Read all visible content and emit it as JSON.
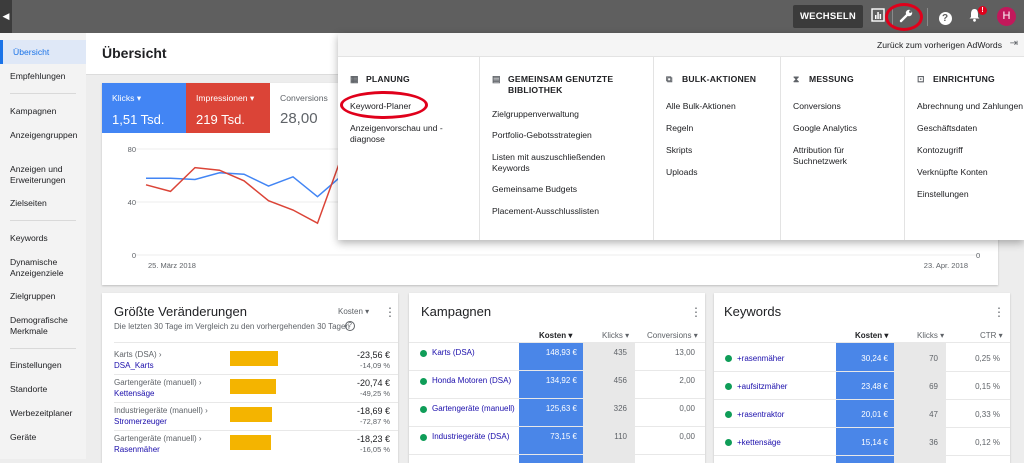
{
  "topbar": {
    "switch_label": "WECHSELN ZU",
    "help_label": "?",
    "bell_badge": "!",
    "avatar_letter": "H"
  },
  "sidebar": {
    "items": [
      "Übersicht",
      "Empfehlungen",
      "Kampagnen",
      "Anzeigengruppen",
      "Anzeigen und Erweiterungen",
      "Zielseiten",
      "Keywords",
      "Dynamische Anzeigenziele",
      "Zielgruppen",
      "Demografische Merkmale",
      "Einstellungen",
      "Standorte",
      "Werbezeitplaner",
      "Geräte"
    ]
  },
  "page": {
    "title": "Übersicht"
  },
  "metrics": [
    {
      "name": "Klicks ▾",
      "value": "1,51 Tsd.",
      "color": "#4285f4"
    },
    {
      "name": "Impressionen ▾",
      "value": "219 Tsd.",
      "color": "#db4437"
    },
    {
      "name": "Conversions",
      "value": "28,00"
    }
  ],
  "chart_data": {
    "type": "line",
    "x": [
      "25. März 2018",
      "23. Apr. 2018"
    ],
    "yticks": [
      "80",
      "40",
      "0"
    ],
    "yticks_right": [
      "0"
    ],
    "series": [
      {
        "name": "Klicks",
        "color": "#4285f4",
        "values": [
          58,
          58,
          57,
          62,
          61,
          52,
          59,
          44,
          60
        ]
      },
      {
        "name": "Impressionen",
        "color": "#db4437",
        "values": [
          53,
          48,
          66,
          64,
          56,
          41,
          34,
          24,
          75
        ]
      }
    ]
  },
  "changes": {
    "title": "Größte Veränderungen",
    "subtitle": "Die letzten 30 Tage im Vergleich zu den vorhergehenden 30 Tagen",
    "sort_label": "Kosten ▾",
    "rows": [
      {
        "campaign": "Karts (DSA) ›",
        "group": "DSA_Karts",
        "value": "-23,56 €",
        "pct": "-14,09 %",
        "bar": 0.83
      },
      {
        "campaign": "Gartengeräte (manuell) ›",
        "group": "Kettensäge",
        "value": "-20,74 €",
        "pct": "-49,25 %",
        "bar": 0.8
      },
      {
        "campaign": "Industriegeräte (manuell) ›",
        "group": "Stromerzeuger",
        "value": "-18,69 €",
        "pct": "-72,87 %",
        "bar": 0.72
      },
      {
        "campaign": "Gartengeräte (manuell) ›",
        "group": "Rasenmäher",
        "value": "-18,23 €",
        "pct": "-16,05 %",
        "bar": 0.7
      }
    ]
  },
  "campaigns": {
    "title": "Kampagnen",
    "cols": [
      "Kosten ▾",
      "Klicks ▾",
      "Conversions ▾"
    ],
    "rows": [
      {
        "name": "Karts (DSA)",
        "cost": "148,93 €",
        "clicks": "435",
        "conv": "13,00"
      },
      {
        "name": "Honda Motoren (DSA)",
        "cost": "134,92 €",
        "clicks": "456",
        "conv": "2,00"
      },
      {
        "name": "Gartengeräte (manuell)",
        "cost": "125,63 €",
        "clicks": "326",
        "conv": "0,00"
      },
      {
        "name": "Industriegeräte (DSA)",
        "cost": "73,15 €",
        "clicks": "110",
        "conv": "0,00"
      }
    ]
  },
  "keywords": {
    "title": "Keywords",
    "cols": [
      "Kosten ▾",
      "Klicks ▾",
      "CTR ▾"
    ],
    "rows": [
      {
        "name": "+rasenmäher",
        "cost": "30,24 €",
        "clicks": "70",
        "ctr": "0,25 %"
      },
      {
        "name": "+aufsitzmäher",
        "cost": "23,48 €",
        "clicks": "69",
        "ctr": "0,15 %"
      },
      {
        "name": "+rasentraktor",
        "cost": "20,01 €",
        "clicks": "47",
        "ctr": "0,33 %"
      },
      {
        "name": "+kettensäge",
        "cost": "15,14 €",
        "clicks": "36",
        "ctr": "0,12 %"
      }
    ]
  },
  "tools_menu": {
    "back_label": "Zurück zum vorherigen AdWords",
    "columns": [
      {
        "title": "PLANUNG",
        "items": [
          "Keyword-Planer",
          "Anzeigenvorschau und -diagnose"
        ]
      },
      {
        "title": "GEMEINSAM GENUTZTE BIBLIOTHEK",
        "items": [
          "Zielgruppenverwaltung",
          "Portfolio-Gebotsstrategien",
          "Listen mit auszuschließenden Keywords",
          "Gemeinsame Budgets",
          "Placement-Ausschlusslisten"
        ]
      },
      {
        "title": "BULK-AKTIONEN",
        "items": [
          "Alle Bulk-Aktionen",
          "Regeln",
          "Skripts",
          "Uploads"
        ]
      },
      {
        "title": "MESSUNG",
        "items": [
          "Conversions",
          "Google Analytics",
          "Attribution für Suchnetzwerk"
        ]
      },
      {
        "title": "EINRICHTUNG",
        "items": [
          "Abrechnung und Zahlungen",
          "Geschäftsdaten",
          "Kontozugriff",
          "Verknüpfte Konten",
          "Einstellungen"
        ]
      }
    ]
  },
  "colors": {
    "accent": "#1a73e8",
    "highlight": "#e0001b",
    "bar": "#f4b400"
  }
}
